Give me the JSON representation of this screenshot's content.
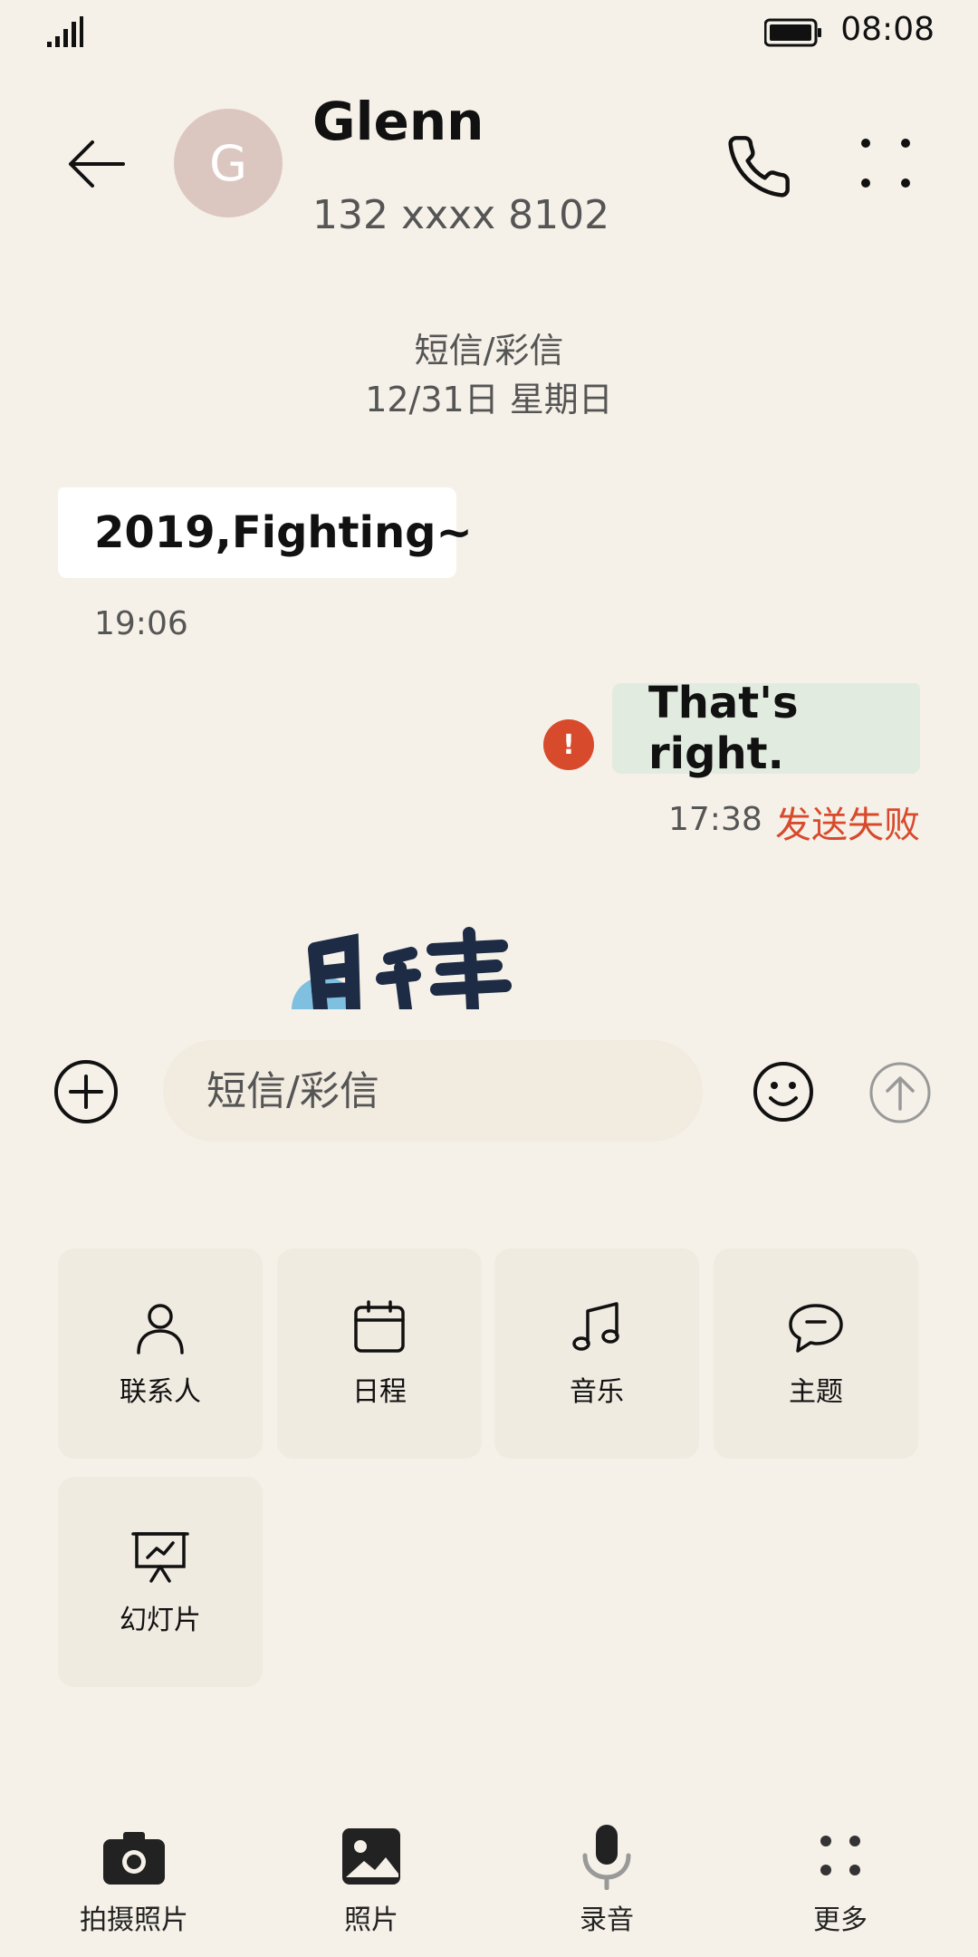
{
  "status_bar": {
    "time": "08:08"
  },
  "header": {
    "avatar_letter": "G",
    "name": "Glenn",
    "number": "132 xxxx 8102"
  },
  "thread": {
    "channel": "短信/彩信",
    "date": "12/31日 星期日"
  },
  "messages": {
    "incoming": {
      "text": "2019,Fighting~",
      "time": "19:06"
    },
    "outgoing": {
      "text": "That's right.",
      "time": "17:38",
      "status": "发送失败",
      "error_glyph": "!"
    }
  },
  "composer": {
    "placeholder": "短信/彩信"
  },
  "attachments": {
    "items": [
      {
        "label": "联系人",
        "icon": "person-icon"
      },
      {
        "label": "日程",
        "icon": "calendar-icon"
      },
      {
        "label": "音乐",
        "icon": "music-note-icon"
      },
      {
        "label": "主题",
        "icon": "chat-bubble-icon"
      },
      {
        "label": "幻灯片",
        "icon": "slideshow-icon"
      }
    ]
  },
  "bottom_bar": {
    "items": [
      {
        "label": "拍摄照片",
        "icon": "camera-icon"
      },
      {
        "label": "照片",
        "icon": "image-icon"
      },
      {
        "label": "录音",
        "icon": "microphone-icon"
      },
      {
        "label": "更多",
        "icon": "dots-grid-icon"
      }
    ]
  },
  "colors": {
    "background": "#f5f1e8",
    "incoming_bubble": "#ffffff",
    "outgoing_bubble": "#e2ebdf",
    "error": "#d84a2c",
    "avatar": "#dcc7c0"
  }
}
